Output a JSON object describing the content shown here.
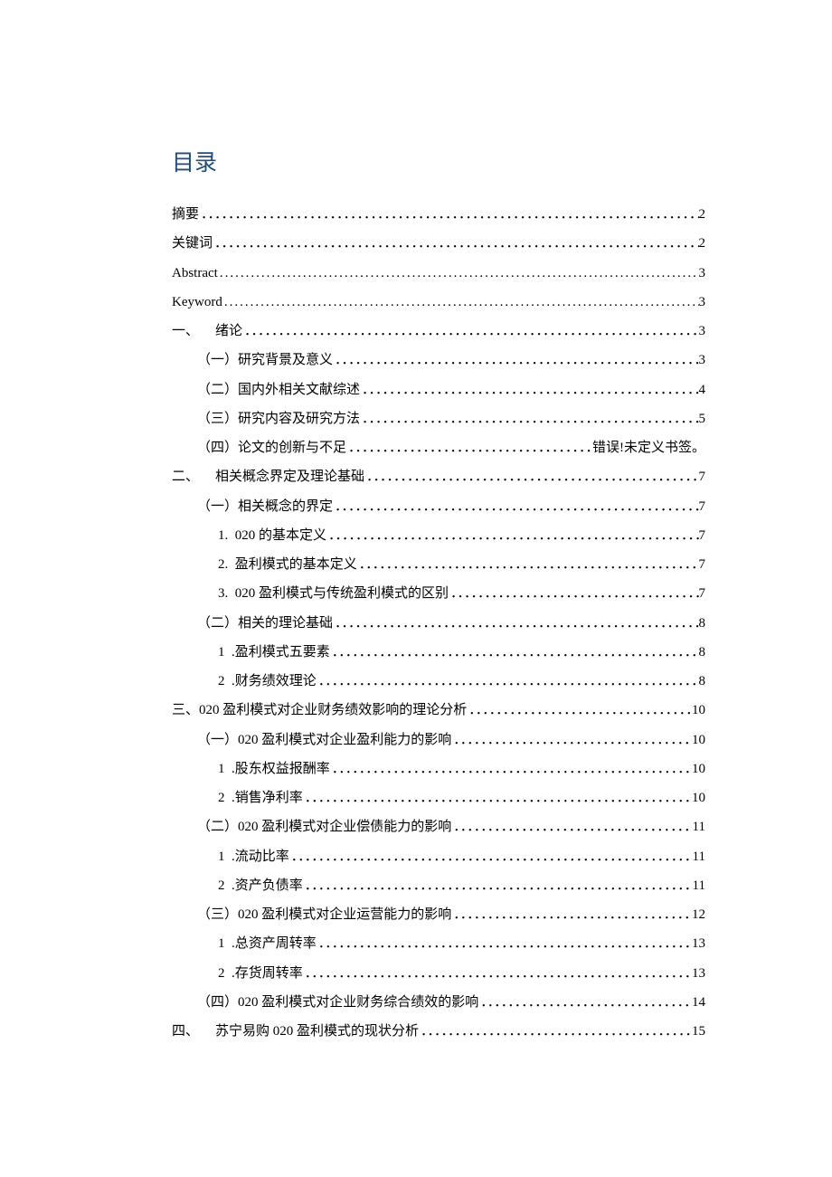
{
  "title": "目录",
  "dot_glyphs": {
    "cjk": "．．．．．．．．．．．．．．．．．．．．．．．．．．．．．．．．．．．．．．．．．．．．．．．．．．．．．．．．．．．．．．．．．．．．．．．．．．．．．．．．．．．．．．．．．．．．．．．．．．．．．．．．．．．．．．．．．．．．．．．．",
    "latin": "........................................................................................................................................................................................................................................................"
  },
  "entries": [
    {
      "label": "摘要",
      "page": "2",
      "indent": 0,
      "dots": "cjk"
    },
    {
      "label": "关键词",
      "page": "2",
      "indent": 0,
      "dots": "cjk"
    },
    {
      "label": "Abstract",
      "page": "3",
      "indent": 0,
      "dots": "latin"
    },
    {
      "label": "Keyword",
      "page": "3",
      "indent": 0,
      "dots": "latin"
    },
    {
      "num": "一、",
      "label": "绪论",
      "page": "3",
      "indent": 0,
      "dots": "cjk",
      "gap": true
    },
    {
      "label": "（一）研究背景及意义",
      "page": "3",
      "indent": 1,
      "dots": "cjk"
    },
    {
      "label": "（二）国内外相关文献综述",
      "page": "4",
      "indent": 1,
      "dots": "cjk"
    },
    {
      "label": "（三）研究内容及研究方法",
      "page": "5",
      "indent": 1,
      "dots": "cjk"
    },
    {
      "label": "（四）论文的创新与不足",
      "page": "错误!未定义书签。",
      "indent": 1,
      "dots": "cjk"
    },
    {
      "num": "二、",
      "label": "相关概念界定及理论基础",
      "page": "7",
      "indent": 0,
      "dots": "cjk",
      "gap": true
    },
    {
      "label": "（一）相关概念的界定",
      "page": "7",
      "indent": 1,
      "dots": "cjk"
    },
    {
      "num": "1.",
      "label": "020 的基本定义",
      "page": "7",
      "indent": 2,
      "dots": "cjk"
    },
    {
      "num": "2.",
      "label": "盈利模式的基本定义",
      "page": "7",
      "indent": 2,
      "dots": "cjk"
    },
    {
      "num": "3.",
      "label": "020 盈利模式与传统盈利模式的区别",
      "page": "7",
      "indent": 2,
      "dots": "cjk"
    },
    {
      "label": "（二）相关的理论基础",
      "page": "8",
      "indent": 1,
      "dots": "cjk"
    },
    {
      "num": "1",
      "label": ".盈利模式五要素",
      "page": "8",
      "indent": 2,
      "dots": "cjk"
    },
    {
      "num": "2",
      "label": ".财务绩效理论",
      "page": "8",
      "indent": 2,
      "dots": "cjk"
    },
    {
      "label": "三、020 盈利模式对企业财务绩效影响的理论分析",
      "page": "10",
      "indent": 0,
      "dots": "cjk"
    },
    {
      "label": "（一）020 盈利模式对企业盈利能力的影响",
      "page": "10",
      "indent": 1,
      "dots": "cjk"
    },
    {
      "num": "1",
      "label": ".股东权益报酬率",
      "page": "10",
      "indent": 2,
      "dots": "cjk"
    },
    {
      "num": "2",
      "label": ".销售净利率",
      "page": "10",
      "indent": 2,
      "dots": "cjk"
    },
    {
      "label": "（二）020 盈利模式对企业偿债能力的影响",
      "page": "11",
      "indent": 1,
      "dots": "cjk"
    },
    {
      "num": "1",
      "label": ".流动比率",
      "page": "11",
      "indent": 2,
      "dots": "cjk"
    },
    {
      "num": "2",
      "label": ".资产负债率",
      "page": "11",
      "indent": 2,
      "dots": "cjk"
    },
    {
      "label": "（三）020 盈利模式对企业运营能力的影响",
      "page": "12",
      "indent": 1,
      "dots": "cjk"
    },
    {
      "num": "1",
      "label": ".总资产周转率",
      "page": "13",
      "indent": 2,
      "dots": "cjk"
    },
    {
      "num": "2",
      "label": ".存货周转率",
      "page": "13",
      "indent": 2,
      "dots": "cjk"
    },
    {
      "label": "（四）020 盈利模式对企业财务综合绩效的影响",
      "page": "14",
      "indent": 1,
      "dots": "cjk"
    },
    {
      "num": "四、",
      "label": "苏宁易购 020 盈利模式的现状分析",
      "page": "15",
      "indent": 0,
      "dots": "cjk",
      "gap": true
    }
  ]
}
